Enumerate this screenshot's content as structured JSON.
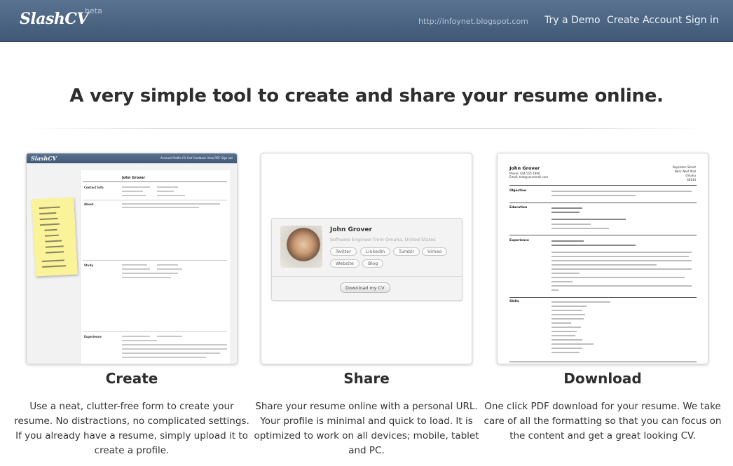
{
  "header": {
    "logo": "SlashCV",
    "badge": "beta",
    "blog_link": "http://infoynet.blogspot.com",
    "nav": {
      "demo": "Try a Demo",
      "create_account": "Create Account",
      "sign_in": "Sign in"
    }
  },
  "tagline": "A very simple tool to create and share your resume online.",
  "features": [
    {
      "title": "Create",
      "description": "Use a neat, clutter-free form to create your resume. No distractions, no complicated settings. If you already have a resume, simply upload it to create a profile."
    },
    {
      "title": "Share",
      "description": "Share your resume online with a personal URL. Your profile is minimal and quick to load. It is optimized to work on all devices; mobile, tablet and PC."
    },
    {
      "title": "Download",
      "description": "One click PDF download for your resume. We take care of all the formatting so that you can focus on the content and get a great looking CV."
    }
  ],
  "create_preview": {
    "logo": "SlashCV",
    "nav": "Account   Profile   CV   Get Feedback   View PDF   Sign out",
    "name": "John Grover",
    "sections": [
      "Contact Info",
      "About",
      "Study",
      "Experience"
    ]
  },
  "share_preview": {
    "name": "John Grover",
    "subtitle": "Software Engineer from Omaha, United States",
    "links": [
      "Twitter",
      "LinkedIn",
      "Tumblr",
      "Vimeo",
      "Website",
      "Blog"
    ],
    "download_label": "Download my CV"
  },
  "download_preview": {
    "name": "John Grover",
    "contact_left": [
      "Phone: 444-555-7890",
      "Email: test@youremail.com"
    ],
    "contact_right": [
      "Poppleton Street",
      "Near West Mall",
      "Omaha",
      "68144"
    ],
    "sections": [
      "Objective",
      "Education",
      "Experience",
      "Skills"
    ]
  }
}
